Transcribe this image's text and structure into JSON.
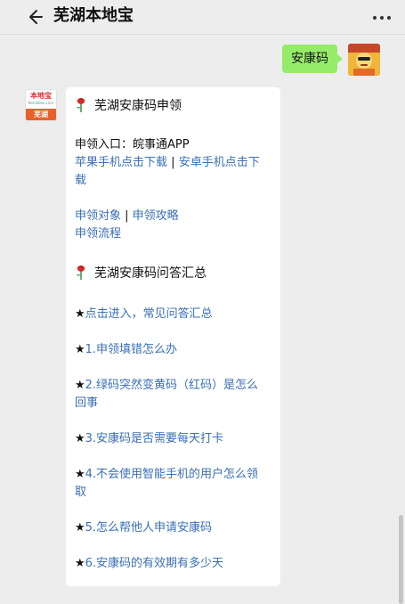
{
  "header": {
    "title": "芜湖本地宝"
  },
  "user_message": {
    "text": "安康码"
  },
  "bot_avatar": {
    "brand": "本地宝",
    "domain": "Bendibao.com",
    "city": "芜湖"
  },
  "card": {
    "section1_title": "芜湖安康码申领",
    "entry_line": "申领入口：皖事通APP",
    "ios_link": "苹果手机点击下载",
    "divider": "|",
    "android_link_part1": "安卓手机点击下",
    "android_link_part2": "载",
    "apply_target": "申领对象",
    "apply_divider": " | ",
    "apply_guide": "申领攻略",
    "apply_flow": "申领流程",
    "section2_title": "芜湖安康码问答汇总",
    "star": "★",
    "qa": [
      {
        "line1": "点击进入，常见问答汇总",
        "line2": ""
      },
      {
        "line1": "1.申领填错怎么办",
        "line2": ""
      },
      {
        "line1": "2.绿码突然变黄码（红码）是怎么",
        "line2": "回事"
      },
      {
        "line1": "3.安康码是否需要每天打卡",
        "line2": ""
      },
      {
        "line1": "4.不会使用智能手机的用户怎么领",
        "line2": "取"
      },
      {
        "line1": "5.怎么帮他人申请安康码",
        "line2": ""
      },
      {
        "line1": "6.安康码的有效期有多少天",
        "line2": ""
      }
    ]
  },
  "colors": {
    "link": "#3a6fb6",
    "bubble_green": "#95ec69",
    "background": "#ededed"
  },
  "icons": [
    "back-arrow-icon",
    "more-dots-icon",
    "rose-icon"
  ]
}
